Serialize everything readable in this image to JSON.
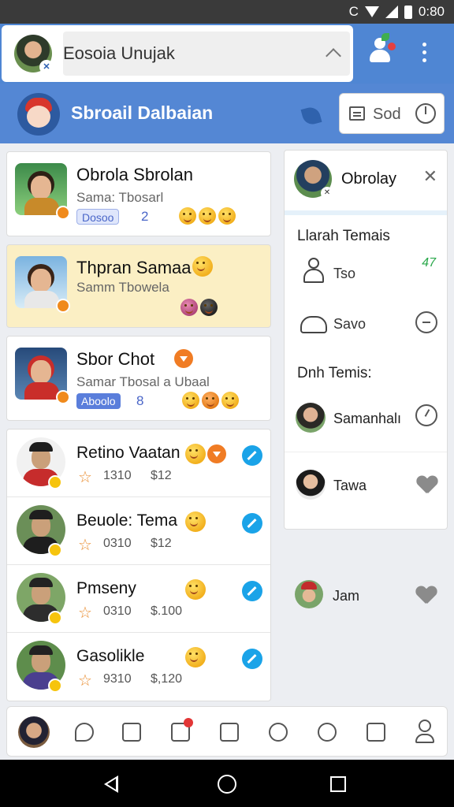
{
  "status_bar": {
    "time": "0:80",
    "carrier_glyph": "C"
  },
  "search": {
    "value": "Eosoia Unujak"
  },
  "app_bar": {
    "title": "Sbroail Dalbaian",
    "action_label": "Sod"
  },
  "chats": [
    {
      "name": "Obrola Sbrolan",
      "preview": "Sama: Tbosarl",
      "badge": "Dosoo",
      "count": "2",
      "highlighted": false
    },
    {
      "name": "Thpran Samaa",
      "preview": "Samm Tbowela",
      "badge": "",
      "count": "",
      "highlighted": true
    },
    {
      "name": "Sbor Chot",
      "preview": "Samar Tbosal a Ubaal",
      "badge": "Aboolo",
      "count": "8",
      "highlighted": false
    }
  ],
  "contacts": [
    {
      "name": "Retino Vaatan",
      "stat1": "1310",
      "stat2": "$12"
    },
    {
      "name": "Beuole: Tema",
      "stat1": "0310",
      "stat2": "$12"
    },
    {
      "name": "Pmseny",
      "stat1": "0310",
      "stat2": "$.100"
    },
    {
      "name": "Gasolikle",
      "stat1": "9310",
      "stat2": "$,120"
    }
  ],
  "panel": {
    "header_name": "Obrolay",
    "section1_title": "Llarah Temais",
    "row1_label": "Tso",
    "row1_value": "47",
    "row2_label": "Savo",
    "section2_title": "Dnh Temis:",
    "people": [
      {
        "name": "Samanhalı"
      },
      {
        "name": "Tawa"
      }
    ],
    "extra_person": "Jam"
  },
  "icons": {
    "header_actions": [
      "person-add-icon",
      "more-vert-icon"
    ],
    "tabs": [
      "profile-avatar",
      "chat-icon",
      "smile-icon",
      "news-icon",
      "doc-icon",
      "bubble-icon",
      "search-icon",
      "grid-icon",
      "account-icon"
    ]
  },
  "colors": {
    "primary": "#5487d4",
    "highlight": "#fbefc4",
    "check": "#1aa3e8",
    "accent": "#f08a1c"
  }
}
